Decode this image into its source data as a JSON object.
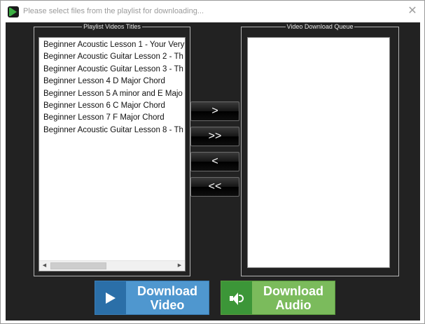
{
  "window": {
    "title": "Please select files from the playlist for downloading...",
    "close_glyph": "✕"
  },
  "playlist": {
    "label": "Playlist Videos Titles",
    "items": [
      "Beginner Acoustic Lesson 1 - Your Very",
      "Beginner Acoustic Guitar Lesson 2 - Th",
      "Beginner Acoustic Guitar Lesson 3 - Th",
      "Beginner Lesson 4 D Major Chord",
      "Beginner Lesson 5 A minor and E Majo",
      "Beginner Lesson 6 C Major Chord",
      "Beginner Lesson 7 F Major Chord",
      "Beginner Acoustic Guitar Lesson 8 - Th"
    ],
    "scroll_left": "◀",
    "scroll_right": "▶"
  },
  "queue": {
    "label": "Video Download Queue",
    "items": []
  },
  "move_buttons": {
    "move_one": ">",
    "move_all": ">>",
    "back_one": "<",
    "back_all": "<<"
  },
  "download": {
    "video": {
      "line1": "Download",
      "line2": "Video",
      "icon": "play-icon"
    },
    "audio": {
      "line1": "Download",
      "line2": "Audio",
      "icon": "speaker-icon"
    }
  },
  "colors": {
    "background": "#222222",
    "video_button": "#4f97cf",
    "audio_button": "#7bbb5c"
  }
}
